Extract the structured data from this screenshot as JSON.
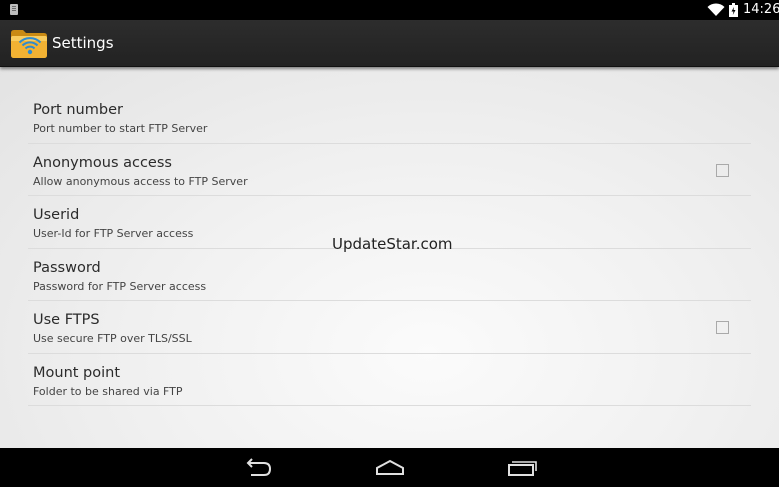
{
  "status_bar": {
    "time": "14:26",
    "icons": [
      "notification-icon",
      "wifi-icon",
      "battery-icon"
    ]
  },
  "action_bar": {
    "title": "Settings",
    "app_icon": "folder-wifi-icon"
  },
  "preferences": [
    {
      "title": "Port number",
      "summary": "Port number to start FTP Server",
      "checkbox": false
    },
    {
      "title": "Anonymous access",
      "summary": "Allow anonymous access to FTP Server",
      "checkbox": true,
      "checked": false
    },
    {
      "title": "Userid",
      "summary": "User-Id for FTP Server access",
      "checkbox": false
    },
    {
      "title": "Password",
      "summary": "Password for FTP Server access",
      "checkbox": false
    },
    {
      "title": "Use FTPS",
      "summary": "Use secure FTP over TLS/SSL",
      "checkbox": true,
      "checked": false
    },
    {
      "title": "Mount point",
      "summary": "Folder to be shared via FTP",
      "checkbox": false
    }
  ],
  "watermark": "UpdateStar.com",
  "navigation": {
    "buttons": [
      "back-icon",
      "home-icon",
      "recent-apps-icon"
    ]
  },
  "colors": {
    "action_bar": "#262626",
    "background": "#efefef",
    "divider": "#dcdcdc",
    "folder": "#f2b233",
    "wifi_symbol": "#2e8bd0"
  }
}
